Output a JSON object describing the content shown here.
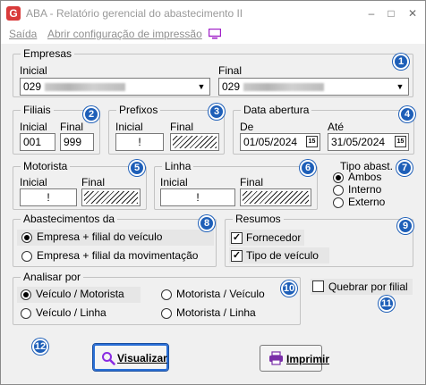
{
  "window": {
    "app_icon_letter": "G",
    "title": "ABA - Relatório gerencial do abastecimento II",
    "minimize": "–",
    "maximize": "□",
    "close": "✕"
  },
  "menu": {
    "exit": "Saída",
    "print_config": "Abrir configuração de impressão"
  },
  "empresas": {
    "title": "Empresas",
    "initial_label": "Inicial",
    "initial_value": "029",
    "final_label": "Final",
    "final_value": "029",
    "badge": "1"
  },
  "filiais": {
    "title": "Filiais",
    "initial_label": "Inicial",
    "initial_value": "001",
    "final_label": "Final",
    "final_value": "999",
    "badge": "2"
  },
  "prefixos": {
    "title": "Prefixos",
    "initial_label": "Inicial",
    "initial_value": "!",
    "final_label": "Final",
    "badge": "3"
  },
  "data_abertura": {
    "title": "Data abertura",
    "from_label": "De",
    "from_value": "01/05/2024",
    "to_label": "Até",
    "to_value": "31/05/2024",
    "cal_icon_text": "15",
    "badge": "4"
  },
  "motorista": {
    "title": "Motorista",
    "initial_label": "Inicial",
    "initial_value": "!",
    "final_label": "Final",
    "badge": "5"
  },
  "linha": {
    "title": "Linha",
    "initial_label": "Inicial",
    "initial_value": "!",
    "final_label": "Final",
    "badge": "6"
  },
  "tipo_abast": {
    "title": "Tipo abast.",
    "options": [
      "Ambos",
      "Interno",
      "Externo"
    ],
    "selected": "Ambos",
    "badge": "7"
  },
  "abastecimentos_da": {
    "title": "Abastecimentos da",
    "options": [
      "Empresa + filial do veículo",
      "Empresa + filial da movimentação"
    ],
    "selected": "Empresa + filial do veículo",
    "badge": "8"
  },
  "resumos": {
    "title": "Resumos",
    "options": [
      "Fornecedor",
      "Tipo de veículo"
    ],
    "checked": [
      "Fornecedor",
      "Tipo de veículo"
    ],
    "badge": "9"
  },
  "analisar_por": {
    "title": "Analisar por",
    "options": [
      "Veículo / Motorista",
      "Motorista / Veículo",
      "Veículo / Linha",
      "Motorista / Linha"
    ],
    "selected": "Veículo / Motorista",
    "badge": "10"
  },
  "quebrar": {
    "label": "Quebrar por filial",
    "checked": false,
    "badge": "11"
  },
  "footer": {
    "badge": "12",
    "visualizar": "Visualizar",
    "imprimir": "Imprimir"
  },
  "colors": {
    "badge": "#1e5fb8",
    "focus": "#2a6fd6",
    "title_text": "#9a9a9a"
  }
}
